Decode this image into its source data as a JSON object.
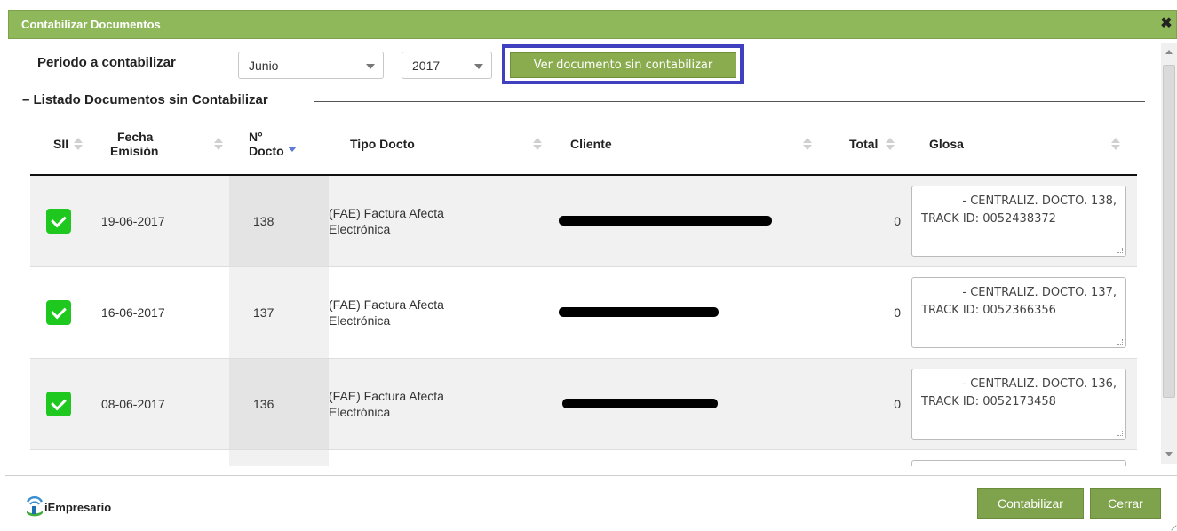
{
  "dialog": {
    "title": "Contabilizar Documentos",
    "close_icon": "close-icon"
  },
  "filters": {
    "period_label": "Periodo a contabilizar",
    "month": "Junio",
    "year": "2017",
    "view_button": "Ver documento sin contabilizar"
  },
  "list": {
    "legend": "– Listado Documentos sin Contabilizar",
    "columns": {
      "sii": "SII",
      "fecha_1": "Fecha",
      "fecha_2": "Emisión",
      "num_1": "N°",
      "num_2": "Docto",
      "tipo": "Tipo Docto",
      "cliente": "Cliente",
      "total": "Total",
      "glosa": "Glosa"
    },
    "rows": [
      {
        "checked": true,
        "fecha": "19-06-2017",
        "num": "138",
        "tipo_1": "(FAE) Factura Afecta",
        "tipo_2": "Electrónica",
        "cliente": "[redacted]",
        "total": "0",
        "glosa_1": "- CENTRALIZ. DOCTO. 138,",
        "glosa_2": "TRACK ID: 0052438372"
      },
      {
        "checked": true,
        "fecha": "16-06-2017",
        "num": "137",
        "tipo_1": "(FAE) Factura Afecta",
        "tipo_2": "Electrónica",
        "cliente": "[redacted]",
        "total": "0",
        "glosa_1": "- CENTRALIZ. DOCTO. 137,",
        "glosa_2": "TRACK ID: 0052366356"
      },
      {
        "checked": true,
        "fecha": "08-06-2017",
        "num": "136",
        "tipo_1": "(FAE) Factura Afecta",
        "tipo_2": "Electrónica",
        "cliente": "[redacted]",
        "total": "0",
        "glosa_1": "- CENTRALIZ. DOCTO. 136,",
        "glosa_2": "TRACK ID: 0052173458"
      }
    ]
  },
  "footer": {
    "logo_text": "iEmpresario",
    "contabilizar": "Contabilizar",
    "cerrar": "Cerrar"
  },
  "colors": {
    "titlebar": "#8fb85a",
    "button": "#7fa24c",
    "highlight": "#3f3fbf",
    "check": "#1ec81e"
  }
}
